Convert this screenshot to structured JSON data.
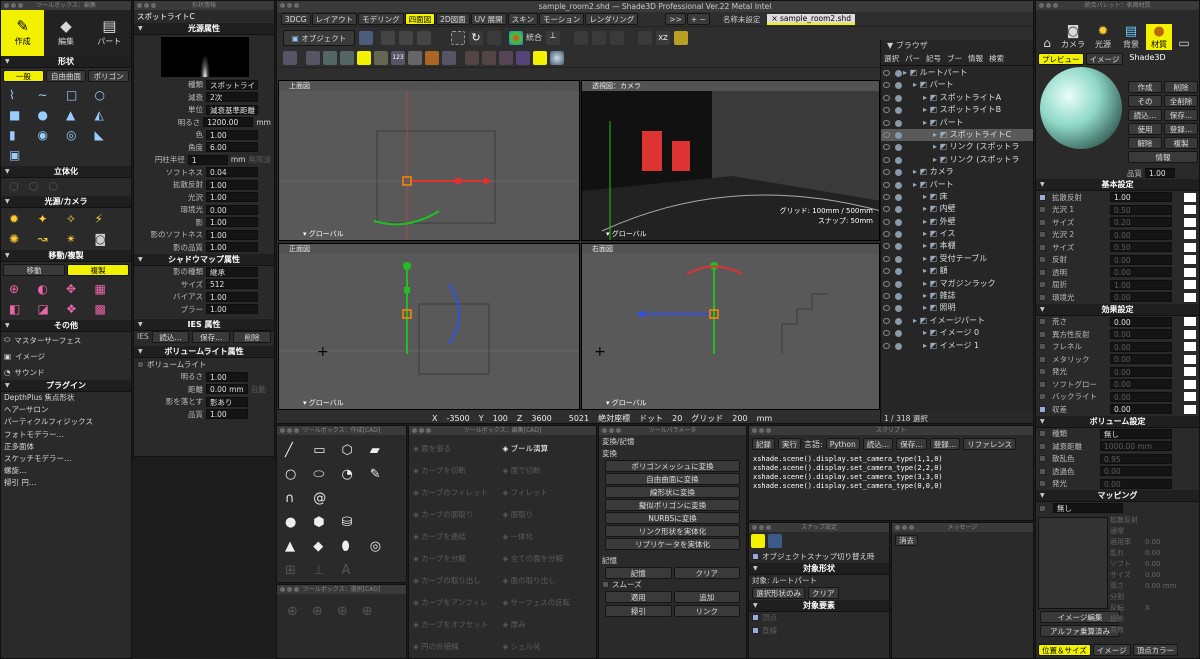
{
  "app_title": "sample_room2.shd — Shade3D Professional Ver.22 Metal Intel",
  "colors": {
    "accent": "#f2f200",
    "material": "#8fd8c8",
    "x_axis": "#e03030",
    "y_axis": "#20c020",
    "z_axis": "#3050e0"
  },
  "left_toolbox": {
    "title": "ツールボックス：編集",
    "modes": [
      "作成",
      "編集",
      "パート"
    ],
    "shape_section": "形状",
    "shape_tabs": [
      "一般",
      "自由曲面",
      "ポリゴン"
    ],
    "solid_section": "立体化",
    "light_section": "光源/カメラ",
    "move_section": "移動/複製",
    "move_tabs": [
      "移動",
      "複製"
    ],
    "other_section": "その他",
    "other_items": [
      "マスターサーフェス",
      "イメージ",
      "サウンド"
    ],
    "plugin_section": "プラグイン",
    "plugins": [
      "DepthPlus 焦点形状",
      "ヘアーサロン",
      "パーティクルフィジックス",
      "フォトモデラー…",
      "正多面体",
      "スケッチモデラー…",
      "螺旋…",
      "掃引 円…"
    ]
  },
  "shape_info": {
    "title": "形状情報",
    "name": "スポットライトC",
    "sec_light": "光源属性",
    "rows": [
      {
        "label": "種類",
        "value": "スポットライ"
      },
      {
        "label": "減衰",
        "value": "2次"
      },
      {
        "label": "単位",
        "value": "減衰基準距離"
      },
      {
        "label": "明るさ",
        "value": "1200.00",
        "unit": "mm"
      },
      {
        "label": "色",
        "value": "1.00"
      },
      {
        "label": "角度",
        "value": "6.00"
      },
      {
        "label": "円柱半径",
        "value": "1",
        "unit": "mm",
        "extra": "無限遠"
      },
      {
        "label": "ソフトネス",
        "value": "0.04"
      },
      {
        "label": "拡散反射",
        "value": "1.00"
      },
      {
        "label": "光沢",
        "value": "1.00"
      },
      {
        "label": "環境光",
        "value": "0.00"
      },
      {
        "label": "影",
        "value": "1.00"
      },
      {
        "label": "影のソフトネス",
        "value": "1.00"
      },
      {
        "label": "影の品質",
        "value": "1.00"
      }
    ],
    "sec_shadow": "シャドウマップ属性",
    "shadow_rows": [
      {
        "label": "影の種類",
        "value": "継承"
      },
      {
        "label": "サイズ",
        "value": "512"
      },
      {
        "label": "バイアス",
        "value": "1.00"
      },
      {
        "label": "ブラー",
        "value": "1.00"
      }
    ],
    "sec_ies": "IES 属性",
    "ies_label": "IES",
    "ies_buttons": [
      "読込…",
      "保存…",
      "削除"
    ],
    "sec_vol": "ボリュームライト属性",
    "vol_check": "ボリュームライト",
    "vol_rows": [
      {
        "label": "明るさ",
        "value": "1.00"
      },
      {
        "label": "距離",
        "value": "0.00 mm",
        "extra": "自動"
      },
      {
        "label": "影を落とす",
        "value": "影あり"
      },
      {
        "label": "品質",
        "value": "1.00"
      }
    ]
  },
  "figure_window": {
    "tabs": [
      "3DCG",
      "レイアウト",
      "モデリング",
      "四面図",
      "2D図面",
      "UV 展開",
      "スキン",
      "モーション",
      "レンダリング"
    ],
    "active_tab": "四面図",
    "more": ">>",
    "file_tabs": [
      "名称未設定",
      "sample_room2.shd"
    ],
    "object_button": "オブジェクト",
    "unify": "統合",
    "viewports": [
      {
        "name": "上面図",
        "footer": "グローバル"
      },
      {
        "name": "透視図：カメラ",
        "footer": "グローバル",
        "grid": "グリッド: 100mm / 500mm",
        "snap": "スナップ: 50mm"
      },
      {
        "name": "正面図",
        "footer": "グローバル"
      },
      {
        "name": "右面図",
        "footer": "グローバル"
      }
    ],
    "status": {
      "x_label": "X",
      "x": "-3500",
      "y_label": "Y",
      "y": "100",
      "z_label": "Z",
      "z": "3600",
      "zoom": "5021",
      "abs_label": "絶対座標",
      "dots_label": "ドット",
      "dots": "20",
      "grid_label": "グリッド",
      "grid": "200",
      "unit": "mm"
    }
  },
  "browser": {
    "title": "ブラウザ",
    "toolbar": [
      "選択",
      "パー",
      "記号",
      "ブー",
      "情報",
      "検索"
    ],
    "count": "1 / 318 選択",
    "items": [
      {
        "label": "ルートパート",
        "indent": 0
      },
      {
        "label": "パート",
        "indent": 1
      },
      {
        "label": "スポットライトA",
        "indent": 2
      },
      {
        "label": "スポットライトB",
        "indent": 2
      },
      {
        "label": "パート",
        "indent": 2
      },
      {
        "label": "スポットライトC",
        "indent": 3,
        "selected": true
      },
      {
        "label": "リンク (スポットラ",
        "indent": 3
      },
      {
        "label": "リンク (スポットラ",
        "indent": 3
      },
      {
        "label": "カメラ",
        "indent": 1
      },
      {
        "label": "パート",
        "indent": 1
      },
      {
        "label": "床",
        "indent": 2
      },
      {
        "label": "内壁",
        "indent": 2
      },
      {
        "label": "外壁",
        "indent": 2
      },
      {
        "label": "イス",
        "indent": 2
      },
      {
        "label": "本棚",
        "indent": 2
      },
      {
        "label": "受付テーブル",
        "indent": 2
      },
      {
        "label": "額",
        "indent": 2
      },
      {
        "label": "マガジンラック",
        "indent": 2
      },
      {
        "label": "雑誌",
        "indent": 2
      },
      {
        "label": "照明",
        "indent": 2
      },
      {
        "label": "イメージパート",
        "indent": 1
      },
      {
        "label": "イメージ 0",
        "indent": 2
      },
      {
        "label": "イメージ 1",
        "indent": 2
      }
    ]
  },
  "palette": {
    "title": "統合パレット：表面材質",
    "tabs": [
      "カメラ",
      "光源",
      "背景",
      "材質"
    ],
    "preview_tabs": [
      "プレビュー",
      "イメージ"
    ],
    "material_name": "Shade3D",
    "buttons": [
      "作成",
      "削除",
      "その",
      "全削除",
      "読込…",
      "保存…",
      "使用",
      "登録…",
      "解除",
      "複製",
      "情報"
    ],
    "quality_label": "品質",
    "quality": "1.00",
    "sec_basic": "基本設定",
    "basic_rows": [
      {
        "label": "拡散反射",
        "value": "1.00",
        "on": true
      },
      {
        "label": "光沢 1",
        "value": "0.50"
      },
      {
        "label": "サイズ",
        "value": "0.20"
      },
      {
        "label": "光沢 2",
        "value": "0.00"
      },
      {
        "label": "サイズ",
        "value": "0.50"
      },
      {
        "label": "反射",
        "value": "0.00"
      },
      {
        "label": "透明",
        "value": "0.00"
      },
      {
        "label": "屈折",
        "value": "1.00"
      },
      {
        "label": "環境光",
        "value": "0.00"
      }
    ],
    "sec_effect": "効果設定",
    "effect_rows": [
      {
        "label": "荒さ",
        "value": "0.00"
      },
      {
        "label": "異方性反射",
        "value": "0.00"
      },
      {
        "label": "フレネル",
        "value": "0.00"
      },
      {
        "label": "メタリック",
        "value": "0.00"
      },
      {
        "label": "発光",
        "value": "0.00"
      },
      {
        "label": "ソフトグロー",
        "value": "0.00"
      },
      {
        "label": "バックライト",
        "value": "0.00"
      },
      {
        "label": "収差",
        "value": "0.00",
        "on": true
      }
    ],
    "sec_volume": "ボリューム設定",
    "volume_rows": [
      {
        "label": "種類",
        "value": "無し"
      },
      {
        "label": "減衰距離",
        "value": "1000.00 mm"
      },
      {
        "label": "散乱色",
        "value": "0.95"
      },
      {
        "label": "透過色",
        "value": "0.00"
      },
      {
        "label": "発光",
        "value": "0.00"
      }
    ],
    "sec_mapping": "マッピング",
    "mapping_type": "無し",
    "map_rows": [
      "拡散反射",
      "通常",
      "適用率",
      "乱れ",
      "ソフト",
      "サイズ",
      "高さ",
      "分割",
      "反転",
      "投影",
      "共有"
    ],
    "map_values": [
      "",
      "",
      "0.00",
      "0.00",
      "0.00",
      "0.00",
      "0.00 mm",
      "",
      "X",
      "",
      ""
    ],
    "image_edit": "イメージ編集",
    "alpha": "アルファ乗算済み",
    "bottom_tabs": [
      "位置＆サイズ",
      "イメージ",
      "頂点カラー"
    ]
  },
  "toolbox_cad": {
    "title": "ツールボックス：作成[CAD]"
  },
  "toolbox_select": {
    "title": "ツールボックス：選択[CAD]"
  },
  "toolbox_edit": {
    "title": "ツールボックス：編集[CAD]",
    "items": [
      "面を張る",
      "カーブを切断",
      "カーブのフィレット",
      "カーブの面取り",
      "カーブを連結",
      "カーブを分解",
      "カーブの取り出し",
      "カーブをアンフィレ",
      "カーブをオフセット",
      "円の外接線"
    ],
    "items2": [
      "ブール演算",
      "面で切断",
      "フィレット",
      "面取り",
      "一体化",
      "全ての面を分解",
      "面の取り出し",
      "サーフェスの反転",
      "厚み",
      "シェル化"
    ]
  },
  "tool_params": {
    "title": "ツールパラメータ",
    "sec1": "変換/記憶",
    "sec1b": "変換",
    "buttons": [
      "ポリゴンメッシュに変換",
      "自由曲面に変換",
      "線形状に変換",
      "擬似ポリゴンに変換",
      "NURBSに変換",
      "リンク形状を実体化",
      "リプリケータを実体化"
    ],
    "sec2": "記憶",
    "mem_buttons": [
      "記憶",
      "クリア"
    ],
    "smooth": "スムーズ",
    "apply": "適用",
    "add": "追加",
    "pull": "掃引",
    "link": "リンク"
  },
  "script": {
    "title": "スクリプト",
    "toolbar": [
      "記録",
      "実行",
      "言語:",
      "Python",
      "読込…",
      "保存…",
      "登録…",
      "リファレンス"
    ],
    "lines": [
      "xshade.scene().display.set_camera_type(1,1,0)",
      "xshade.scene().display.set_camera_type(2,2,0)",
      "xshade.scene().display.set_camera_type(3,3,0)",
      "xshade.scene().display.set_camera_type(0,0,0)"
    ]
  },
  "snap": {
    "title": "スナップ設定",
    "object_snap": "オブジェクトスナップ切り替え時",
    "target_shape": "対象形状",
    "target_label": "対象: ルートパート",
    "select_only": "選択形状のみ",
    "clear": "クリア",
    "target_elem": "対象要素",
    "elems": [
      "頂点",
      "直線"
    ]
  },
  "message": {
    "title": "メッセージ",
    "text": "消去"
  }
}
